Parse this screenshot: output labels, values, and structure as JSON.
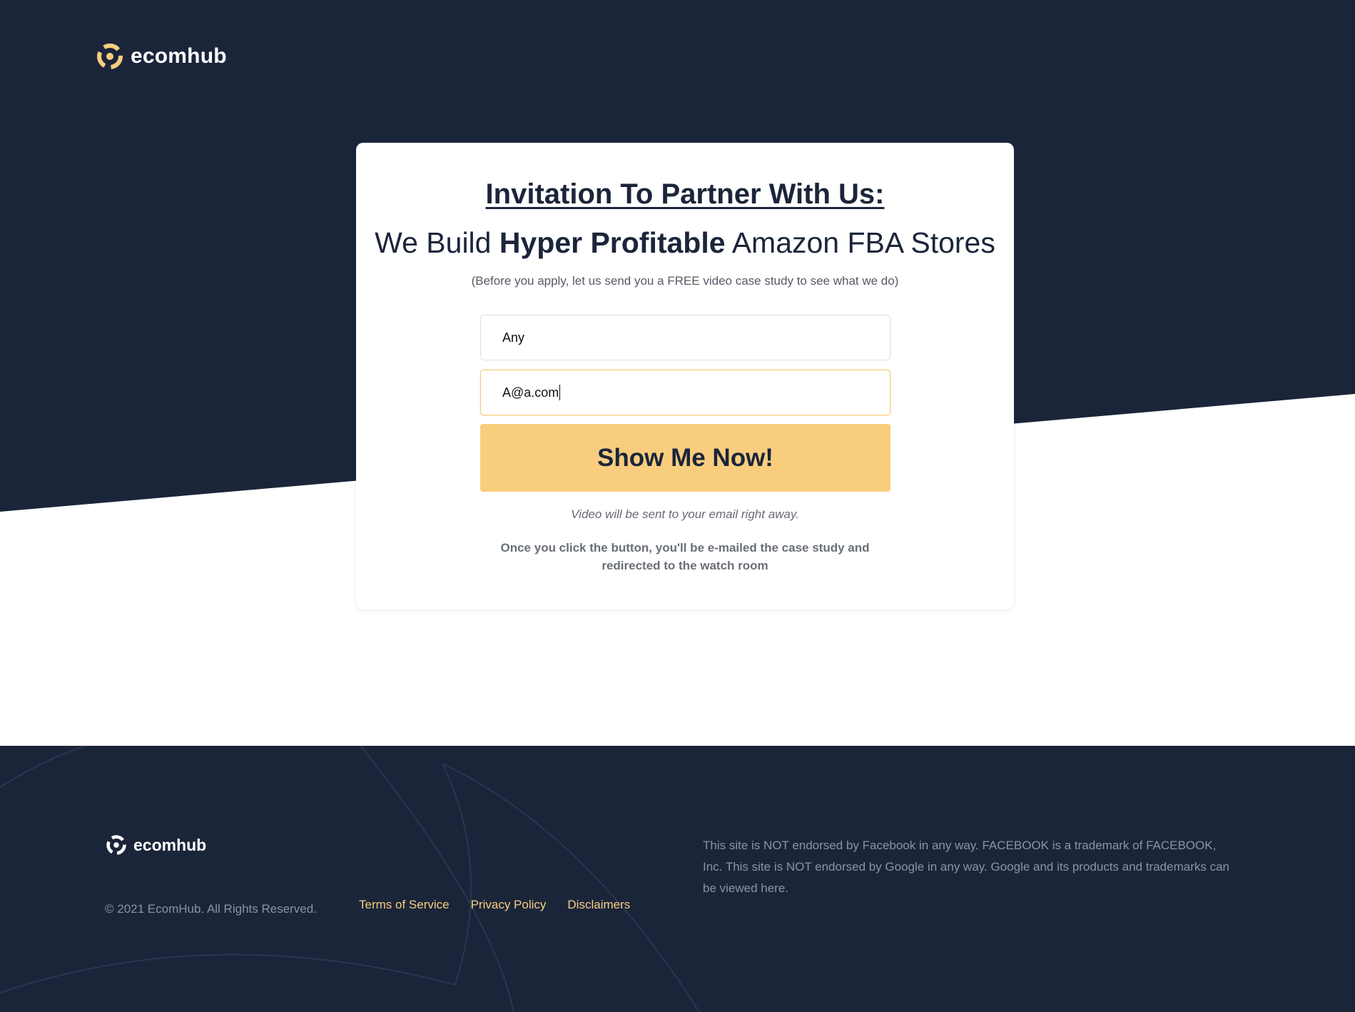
{
  "header": {
    "brand": "ecomhub"
  },
  "card": {
    "title": "Invitation To Partner With Us:",
    "headline": {
      "prefix": "We Build ",
      "bold": "Hyper Profitable",
      "suffix": " Amazon FBA Stores"
    },
    "subtitle": "(Before you apply, let us send you a FREE video case study to see what we do)",
    "name_value": "Any",
    "email_value": "A@a.com",
    "cta_label": "Show Me Now!",
    "note_italic": "Video will be sent to your email right away.",
    "note_bold": "Once you click the button, you'll be e-mailed the case study and redirected to the watch room"
  },
  "footer": {
    "brand": "ecomhub",
    "copyright": "© 2021 EcomHub. All Rights Reserved.",
    "links": [
      "Terms of Service",
      "Privacy Policy",
      "Disclaimers"
    ],
    "disclaimer": "This site is NOT endorsed by Facebook in any way. FACEBOOK is a trademark of FACEBOOK, Inc. This site is NOT endorsed by Google in any way. Google and its products and trademarks can be viewed here."
  },
  "colors": {
    "navy": "#1b253a",
    "accent": "#f8ce7e",
    "white": "#ffffff"
  }
}
